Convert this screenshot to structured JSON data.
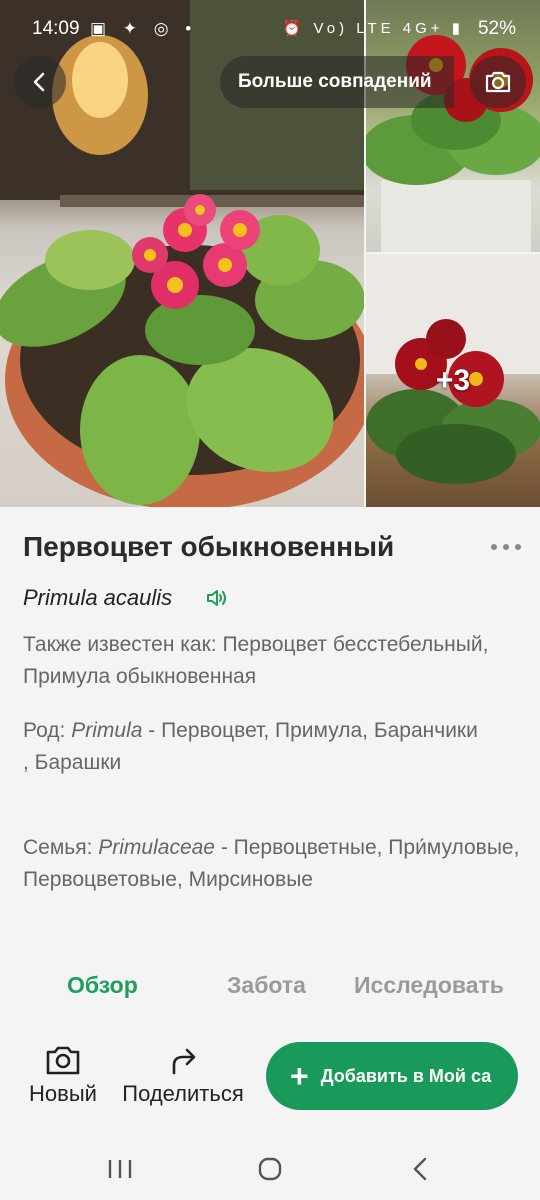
{
  "status_bar": {
    "time": "14:09",
    "left_icons": "▣ ✦ ◎ •",
    "right_icons": "⏰ Vo) LTE 4G+ ▮",
    "battery": "52%"
  },
  "header": {
    "more_matches_label": "Больше совпадений",
    "back_icon": "chevron-left-icon",
    "camera_icon": "camera-icon"
  },
  "gallery": {
    "more_photos_label": "+3"
  },
  "plant": {
    "common_name": "Первоцвет обыкновенный",
    "latin_name": "Primula acaulis",
    "also_known_as": "Также известен как: Первоцвет бесстебельный, Примула обыкновенная",
    "genus_prefix": "Род: ",
    "genus_latin": "Primula",
    "genus_names": " - Первоцвет, Примула, Баранчики",
    "genus_names_cont": ", Барашки",
    "family_prefix": "Семья: ",
    "family_latin": "Primulaceae",
    "family_names": " - Первоцветные, При́муловые, Первоцветовые, Мирсиновые"
  },
  "tabs": [
    {
      "label": "Обзор",
      "active": true
    },
    {
      "label": "Забота",
      "active": false
    },
    {
      "label": "Исследовать",
      "active": false
    }
  ],
  "actions": {
    "new_label": "Новый",
    "share_label": "Поделиться",
    "add_label": "Добавить в Мой са"
  },
  "colors": {
    "accent_green": "#1a9a5a",
    "active_tab": "#1e9e5c",
    "inactive_tab": "#9a9a9a"
  }
}
